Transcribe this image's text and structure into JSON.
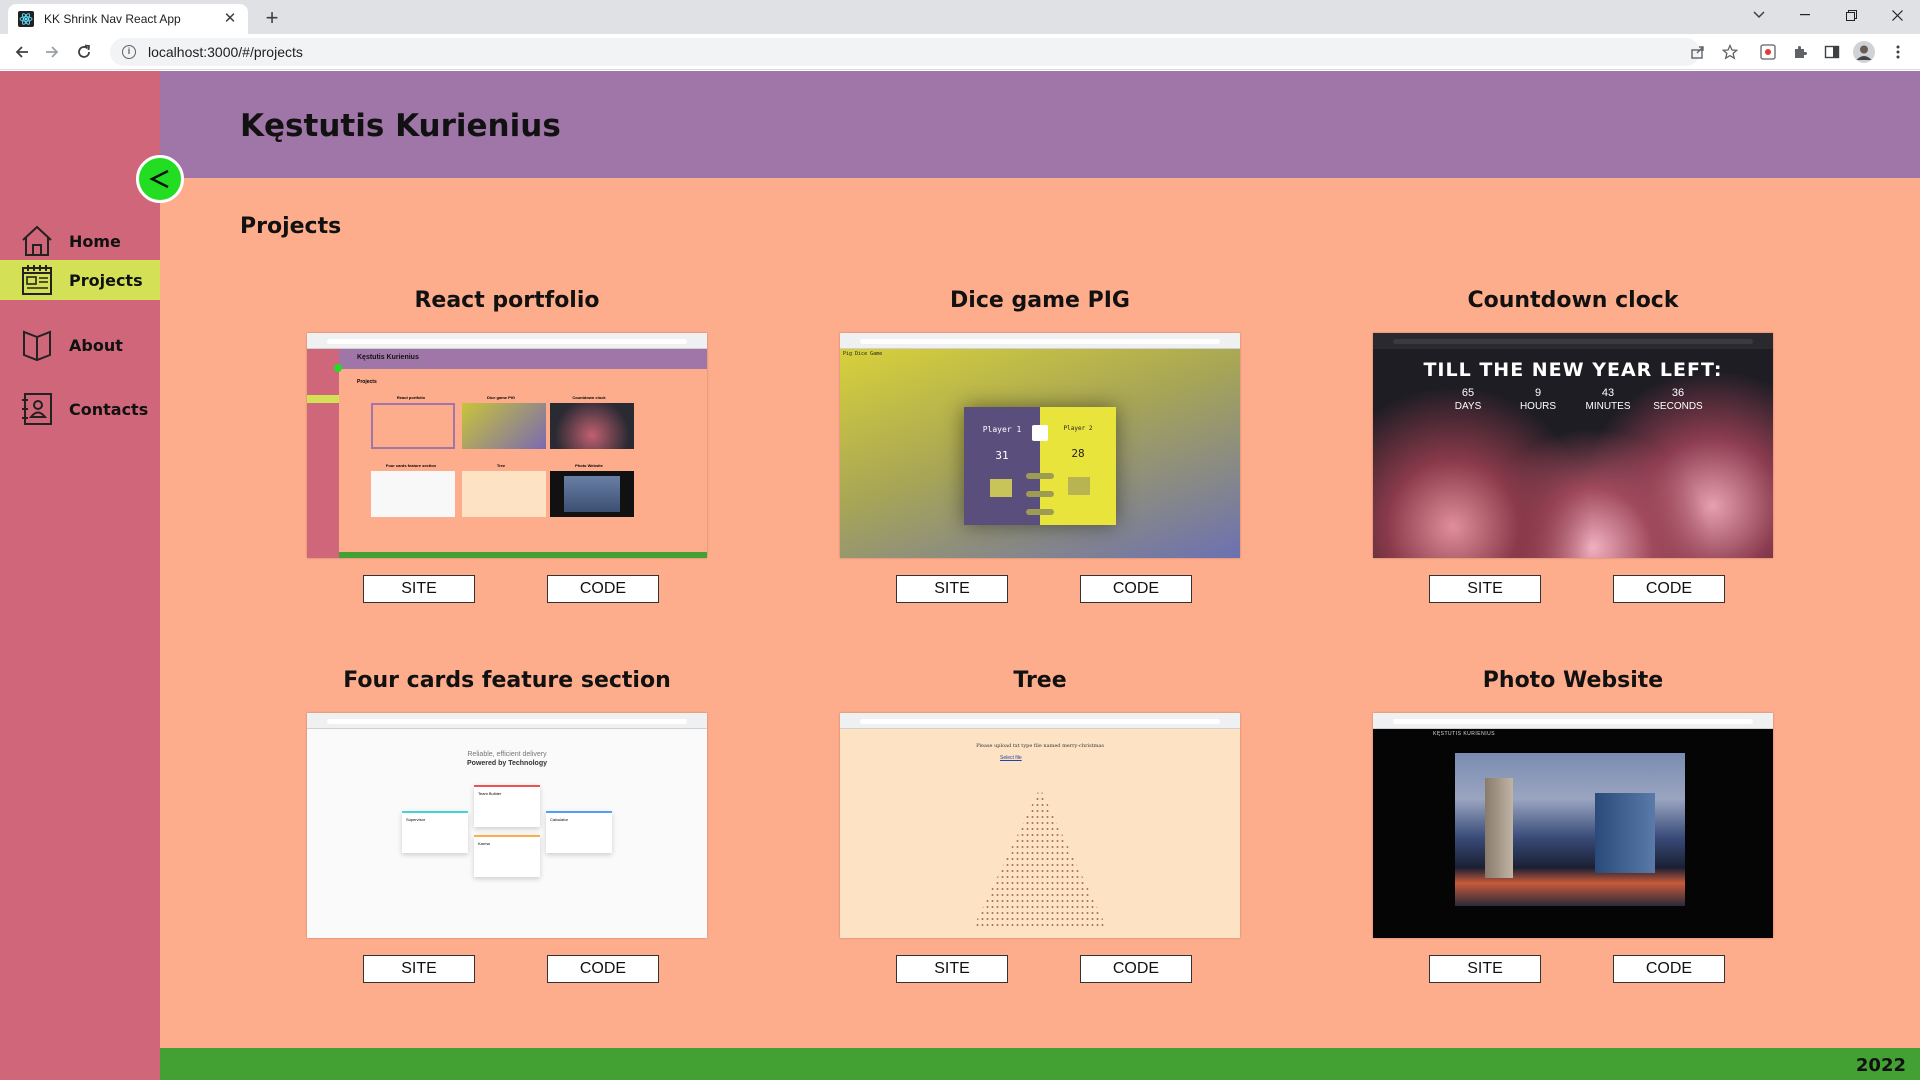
{
  "browser": {
    "tab_title": "KK Shrink Nav React App",
    "url": "localhost:3000/#/projects"
  },
  "app": {
    "owner_name": "Kęstutis Kurienius",
    "toggle_label": "<",
    "nav": [
      {
        "label": "Home",
        "icon": "home-icon"
      },
      {
        "label": "Projects",
        "icon": "projects-icon",
        "active": true
      },
      {
        "label": "About",
        "icon": "book-icon"
      },
      {
        "label": "Contacts",
        "icon": "contact-card-icon"
      }
    ],
    "section_title": "Projects",
    "projects": [
      {
        "title": "React portfolio",
        "site": "SITE",
        "code": "CODE"
      },
      {
        "title": "Dice game PIG",
        "site": "SITE",
        "code": "CODE"
      },
      {
        "title": "Countdown clock",
        "site": "SITE",
        "code": "CODE"
      },
      {
        "title": "Four cards feature section",
        "site": "SITE",
        "code": "CODE"
      },
      {
        "title": "Tree",
        "site": "SITE",
        "code": "CODE"
      },
      {
        "title": "Photo Website",
        "site": "SITE",
        "code": "CODE"
      }
    ],
    "thumbnails": {
      "portfolio": {
        "header": "Kęstutis Kurienius",
        "section": "Projects",
        "cards": [
          "React portfolio",
          "Dice game PIG",
          "Countdown clock",
          "Four cards feature section",
          "Tree",
          "Photo Website"
        ]
      },
      "dice": {
        "title": "Pig Dice Game",
        "player1": "Player 1",
        "player2": "Player 2",
        "score1": "31",
        "score2": "28"
      },
      "countdown": {
        "heading": "TILL THE NEW YEAR LEFT:",
        "values": [
          "65",
          "9",
          "43",
          "36"
        ],
        "units": [
          "DAYS",
          "HOURS",
          "MINUTES",
          "SECONDS"
        ]
      },
      "fourcards": {
        "line1": "Reliable, efficient delivery",
        "line2": "Powered by Technology",
        "cards": [
          "Supervisor",
          "Team Builder",
          "Karma",
          "Calculator"
        ]
      },
      "tree": {
        "prompt": "Please upload txt type file named merry-christmas",
        "button": "Select file"
      },
      "photo": {
        "brand": "KĘSTUTIS KURIENIUS"
      }
    },
    "footer_year": "2022"
  },
  "colors": {
    "sidebar": "#cf6679",
    "header": "#a076a8",
    "content": "#fead8c",
    "active_nav": "#d4e157",
    "toggle": "#22dd22",
    "footer": "#43a033"
  }
}
